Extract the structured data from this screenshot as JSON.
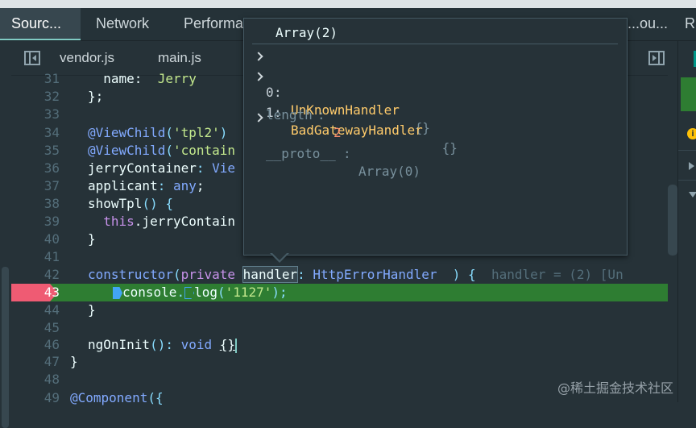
{
  "devtools_tabs": [
    "Sourc...",
    "Network",
    "Performa",
    "...ou...",
    "R"
  ],
  "file_tabs": [
    "vendor.js",
    "main.js"
  ],
  "code_lines": [
    {
      "num": "31",
      "tokens": [
        {
          "t": "  name:  ",
          "c": "tok-plain"
        },
        {
          "t": "Jerry",
          "c": "tok-str"
        }
      ]
    },
    {
      "num": "32",
      "tokens": [
        {
          "t": "};",
          "c": "tok-plain"
        }
      ]
    },
    {
      "num": "33",
      "tokens": []
    },
    {
      "num": "34",
      "tokens": [
        {
          "t": "@ViewChild",
          "c": "tok-dec"
        },
        {
          "t": "(",
          "c": "tok-punc"
        },
        {
          "t": "'tpl2'",
          "c": "tok-str"
        },
        {
          "t": ")",
          "c": "tok-punc"
        }
      ]
    },
    {
      "num": "35",
      "tokens": [
        {
          "t": "@ViewChild",
          "c": "tok-dec"
        },
        {
          "t": "(",
          "c": "tok-punc"
        },
        {
          "t": "'contain",
          "c": "tok-str"
        }
      ]
    },
    {
      "num": "36",
      "tokens": [
        {
          "t": "jerryContainer",
          "c": "tok-plain"
        },
        {
          "t": ": ",
          "c": "tok-punc"
        },
        {
          "t": "Vie",
          "c": "tok-type"
        }
      ]
    },
    {
      "num": "37",
      "tokens": [
        {
          "t": "applicant",
          "c": "tok-plain"
        },
        {
          "t": ": ",
          "c": "tok-punc"
        },
        {
          "t": "any",
          "c": "tok-type"
        },
        {
          "t": ";",
          "c": "tok-plain"
        }
      ]
    },
    {
      "num": "38",
      "tokens": [
        {
          "t": "showTpl",
          "c": "tok-plain"
        },
        {
          "t": "() {",
          "c": "tok-punc"
        }
      ]
    },
    {
      "num": "39",
      "tokens": [
        {
          "t": "  this",
          "c": "tok-this"
        },
        {
          "t": ".jerryContain",
          "c": "tok-plain"
        }
      ]
    },
    {
      "num": "40",
      "tokens": [
        {
          "t": "}",
          "c": "tok-plain"
        }
      ]
    },
    {
      "num": "41",
      "tokens": []
    },
    {
      "num": "42",
      "tokens": [
        {
          "t": "constructor",
          "c": "tok-fn"
        },
        {
          "t": "(",
          "c": "tok-punc"
        },
        {
          "t": "private ",
          "c": "tok-kw"
        },
        {
          "t": "handler",
          "c": "tok-plain hl-word"
        },
        {
          "t": ": ",
          "c": "tok-punc"
        },
        {
          "t": "HttpErrorHandler  ",
          "c": "tok-type"
        },
        {
          "t": ") {",
          "c": "tok-punc"
        },
        {
          "t": "  handler = (2) [Un",
          "c": "inline-val"
        }
      ]
    },
    {
      "num": "43",
      "tokens": [
        {
          "t": "console",
          "c": "tok-plain"
        },
        {
          "t": ".",
          "c": "tok-punc"
        },
        {
          "t": "log",
          "c": "tok-plain"
        },
        {
          "t": "(",
          "c": "tok-punc"
        },
        {
          "t": "'1127'",
          "c": "tok-str"
        },
        {
          "t": ");",
          "c": "tok-punc"
        }
      ]
    },
    {
      "num": "44",
      "tokens": [
        {
          "t": "}",
          "c": "tok-plain"
        }
      ]
    },
    {
      "num": "45",
      "tokens": []
    },
    {
      "num": "46",
      "tokens": [
        {
          "t": "ngOnInit",
          "c": "tok-plain"
        },
        {
          "t": "(): ",
          "c": "tok-punc"
        },
        {
          "t": "void ",
          "c": "tok-type"
        },
        {
          "t": "{}",
          "c": "tok-plain ul"
        }
      ]
    },
    {
      "num": "47",
      "tokens": [
        {
          "t": "}",
          "c": "tok-plain"
        }
      ]
    },
    {
      "num": "48",
      "tokens": []
    },
    {
      "num": "49",
      "tokens": [
        {
          "t": "@Component",
          "c": "tok-dec"
        },
        {
          "t": "({",
          "c": "tok-punc"
        }
      ]
    }
  ],
  "popup": {
    "title": "Array(2)",
    "items": [
      {
        "key": "0",
        "value": "UnKnownHandler",
        "extra": " {}"
      },
      {
        "key": "1",
        "value": "BadGatewayHandler",
        "extra": " {}"
      }
    ],
    "length_key": "length",
    "length_value": "2",
    "proto_key": "__proto__",
    "proto_value": "Array(0)"
  },
  "right_panel": {
    "info_icon": "i"
  },
  "watermark": "@稀土掘金技术社区"
}
